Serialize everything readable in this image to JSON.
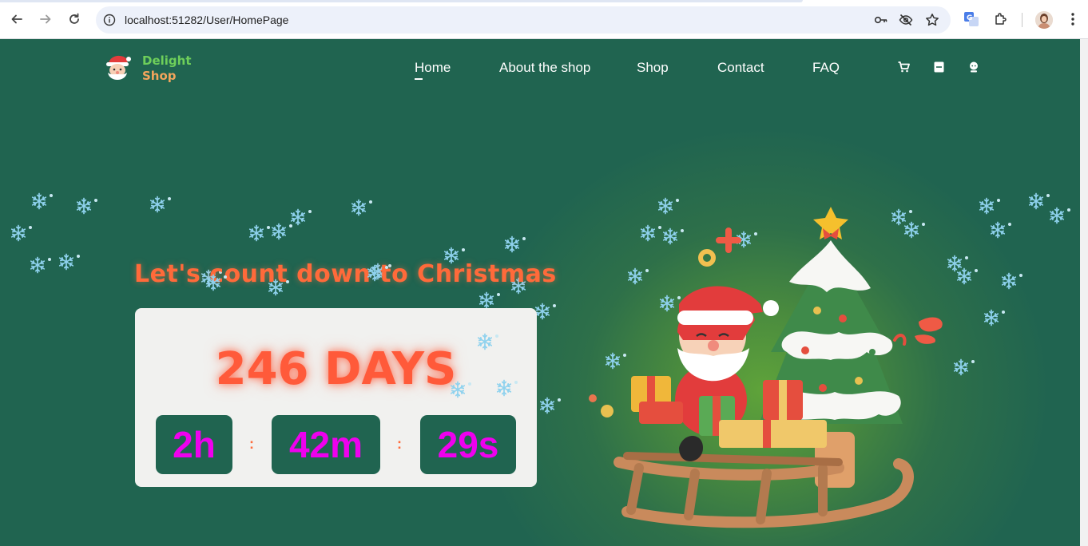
{
  "browser": {
    "url": "localhost:51282/User/HomePage"
  },
  "brand": {
    "line1": "Delight",
    "line2": "Shop"
  },
  "nav": {
    "items": [
      "Home",
      "About the shop",
      "Shop",
      "Contact",
      "FAQ"
    ],
    "active": "Home"
  },
  "hero": {
    "headline": "Let's count down to Christmas",
    "days": "246 DAYS",
    "hours": "2h",
    "minutes": "42m",
    "seconds": "29s",
    "separator": ":"
  },
  "icons": {
    "browser": [
      "back-arrow-icon",
      "forward-arrow-icon",
      "reload-icon",
      "site-info-icon",
      "key-icon",
      "eye-off-icon",
      "star-icon",
      "translate-icon",
      "extensions-icon",
      "menu-kebab-icon"
    ],
    "header": [
      "cart-icon",
      "document-icon",
      "user-icon"
    ]
  },
  "colors": {
    "background": "#206450",
    "accent_orange": "#ff6a3a",
    "timer_magenta": "#ee00ee",
    "card": "#f1f1ef"
  }
}
